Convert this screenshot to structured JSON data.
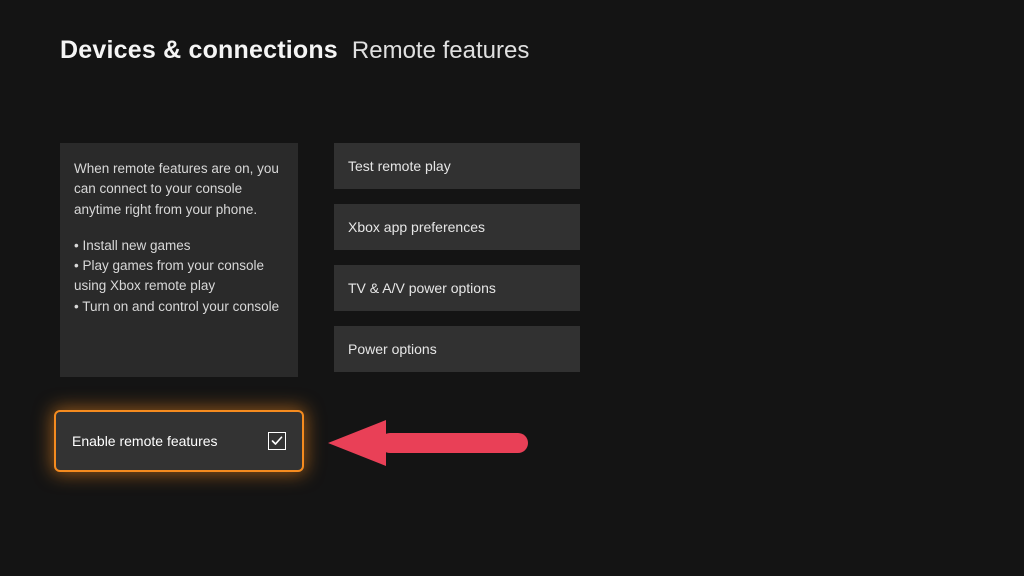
{
  "header": {
    "title": "Devices & connections",
    "subtitle": "Remote features"
  },
  "info": {
    "intro": "When remote features are on, you can connect to your console anytime right from your phone.",
    "bullets": [
      "• Install new games",
      "• Play games from your console using Xbox remote play",
      "• Turn on and control your console"
    ]
  },
  "menu": {
    "items": [
      "Test remote play",
      "Xbox app preferences",
      "TV & A/V power options",
      "Power options"
    ]
  },
  "enable": {
    "label": "Enable remote features",
    "checked": true
  },
  "colors": {
    "highlight": "#f58b1f",
    "arrow": "#e94057"
  }
}
